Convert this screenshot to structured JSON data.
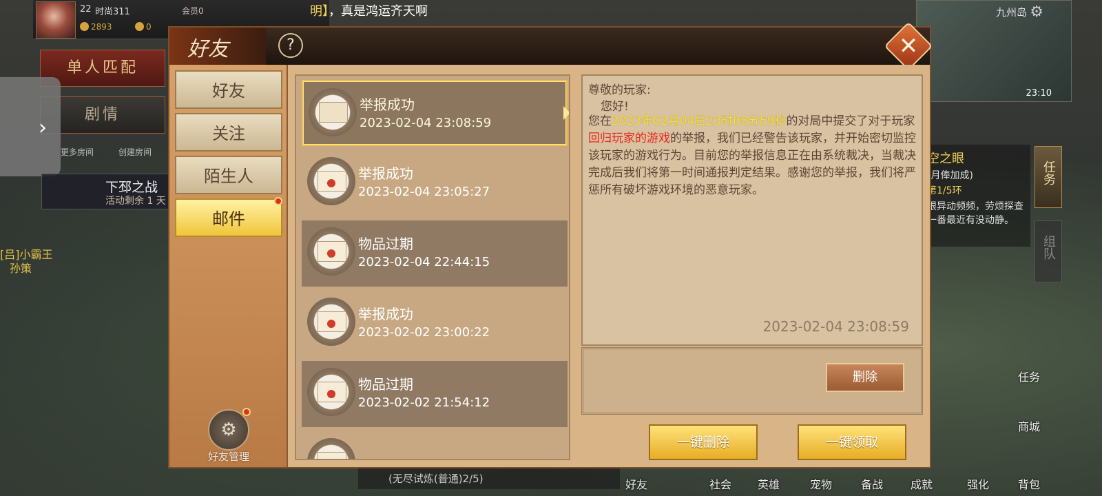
{
  "hud": {
    "level": "22",
    "player_name": "时尚311",
    "vip": "会员0",
    "coins": "2893",
    "gold": "0",
    "marquee_highlight": "明】",
    "marquee_text": "，真是鸿运齐天啊",
    "left_buttons": [
      "单人匹配",
      "剧情"
    ],
    "room_links": [
      "更多房间",
      "创建房间"
    ],
    "event_title": "下邳之战",
    "event_sub": "活动剩余 1 天",
    "player_bubble": [
      "[吕]小霸王",
      "孙策"
    ],
    "location": "九州岛",
    "clock": "23:10"
  },
  "task_panel": {
    "title": "空之眼",
    "line2": "(月俸加成)",
    "line3": "第1/5环",
    "line4": "眼异动频频，劳烦探查一番最近有没动静。"
  },
  "side_tabs": [
    "任务",
    "组队"
  ],
  "bottom_bar": {
    "quest_text": "(无尽试炼(普通)2/5)",
    "items": [
      "好友",
      "社会",
      "英雄",
      "宠物",
      "备战",
      "成就",
      "强化",
      "背包"
    ],
    "right_items": [
      "任务",
      "商城"
    ]
  },
  "dialog": {
    "title": "好友",
    "help_symbol": "?",
    "close_symbol": "✕",
    "nav": [
      {
        "label": "好友"
      },
      {
        "label": "关注"
      },
      {
        "label": "陌生人"
      },
      {
        "label": "邮件"
      }
    ],
    "manager_label": "好友管理",
    "mails": [
      {
        "title": "举报成功",
        "time": "2023-02-04 23:08:59"
      },
      {
        "title": "举报成功",
        "time": "2023-02-04 23:05:27"
      },
      {
        "title": "物品过期",
        "time": "2023-02-04 22:44:15"
      },
      {
        "title": "举报成功",
        "time": "2023-02-02 23:00:22"
      },
      {
        "title": "物品过期",
        "time": "2023-02-02 21:54:12"
      }
    ],
    "detail": {
      "salutation": "尊敬的玩家:",
      "greeting": "您好!",
      "p1": "您在",
      "date": "2023年02月04日23时08分59秒",
      "p2": "的对局中提交了对于玩家",
      "game": "回归玩家的游戏",
      "p3": "的举报，我们已经警告该玩家，并开始密切监控该玩家的游戏行为。目前您的举报信息正在由系统裁决，当裁决完成后我们将第一时间通报判定结果。感谢您的举报，我们将严惩所有破坏游戏环境的恶意玩家。",
      "sent_time": "2023-02-04 23:08:59"
    },
    "delete_label": "删除",
    "delete_all_label": "一键删除",
    "claim_all_label": "一键领取"
  },
  "colors": {
    "accent_gold": "#f0c53c",
    "highlight_yellow": "#f5e23a",
    "highlight_red": "#e8261a"
  }
}
